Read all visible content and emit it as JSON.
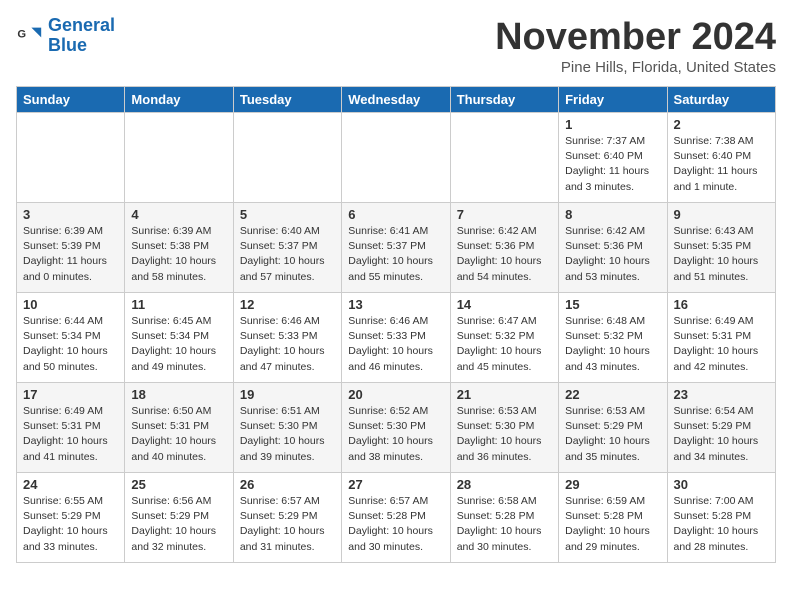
{
  "header": {
    "logo_general": "General",
    "logo_blue": "Blue",
    "month": "November 2024",
    "location": "Pine Hills, Florida, United States"
  },
  "weekdays": [
    "Sunday",
    "Monday",
    "Tuesday",
    "Wednesday",
    "Thursday",
    "Friday",
    "Saturday"
  ],
  "weeks": [
    [
      {
        "day": "",
        "info": ""
      },
      {
        "day": "",
        "info": ""
      },
      {
        "day": "",
        "info": ""
      },
      {
        "day": "",
        "info": ""
      },
      {
        "day": "",
        "info": ""
      },
      {
        "day": "1",
        "info": "Sunrise: 7:37 AM\nSunset: 6:40 PM\nDaylight: 11 hours\nand 3 minutes."
      },
      {
        "day": "2",
        "info": "Sunrise: 7:38 AM\nSunset: 6:40 PM\nDaylight: 11 hours\nand 1 minute."
      }
    ],
    [
      {
        "day": "3",
        "info": "Sunrise: 6:39 AM\nSunset: 5:39 PM\nDaylight: 11 hours\nand 0 minutes."
      },
      {
        "day": "4",
        "info": "Sunrise: 6:39 AM\nSunset: 5:38 PM\nDaylight: 10 hours\nand 58 minutes."
      },
      {
        "day": "5",
        "info": "Sunrise: 6:40 AM\nSunset: 5:37 PM\nDaylight: 10 hours\nand 57 minutes."
      },
      {
        "day": "6",
        "info": "Sunrise: 6:41 AM\nSunset: 5:37 PM\nDaylight: 10 hours\nand 55 minutes."
      },
      {
        "day": "7",
        "info": "Sunrise: 6:42 AM\nSunset: 5:36 PM\nDaylight: 10 hours\nand 54 minutes."
      },
      {
        "day": "8",
        "info": "Sunrise: 6:42 AM\nSunset: 5:36 PM\nDaylight: 10 hours\nand 53 minutes."
      },
      {
        "day": "9",
        "info": "Sunrise: 6:43 AM\nSunset: 5:35 PM\nDaylight: 10 hours\nand 51 minutes."
      }
    ],
    [
      {
        "day": "10",
        "info": "Sunrise: 6:44 AM\nSunset: 5:34 PM\nDaylight: 10 hours\nand 50 minutes."
      },
      {
        "day": "11",
        "info": "Sunrise: 6:45 AM\nSunset: 5:34 PM\nDaylight: 10 hours\nand 49 minutes."
      },
      {
        "day": "12",
        "info": "Sunrise: 6:46 AM\nSunset: 5:33 PM\nDaylight: 10 hours\nand 47 minutes."
      },
      {
        "day": "13",
        "info": "Sunrise: 6:46 AM\nSunset: 5:33 PM\nDaylight: 10 hours\nand 46 minutes."
      },
      {
        "day": "14",
        "info": "Sunrise: 6:47 AM\nSunset: 5:32 PM\nDaylight: 10 hours\nand 45 minutes."
      },
      {
        "day": "15",
        "info": "Sunrise: 6:48 AM\nSunset: 5:32 PM\nDaylight: 10 hours\nand 43 minutes."
      },
      {
        "day": "16",
        "info": "Sunrise: 6:49 AM\nSunset: 5:31 PM\nDaylight: 10 hours\nand 42 minutes."
      }
    ],
    [
      {
        "day": "17",
        "info": "Sunrise: 6:49 AM\nSunset: 5:31 PM\nDaylight: 10 hours\nand 41 minutes."
      },
      {
        "day": "18",
        "info": "Sunrise: 6:50 AM\nSunset: 5:31 PM\nDaylight: 10 hours\nand 40 minutes."
      },
      {
        "day": "19",
        "info": "Sunrise: 6:51 AM\nSunset: 5:30 PM\nDaylight: 10 hours\nand 39 minutes."
      },
      {
        "day": "20",
        "info": "Sunrise: 6:52 AM\nSunset: 5:30 PM\nDaylight: 10 hours\nand 38 minutes."
      },
      {
        "day": "21",
        "info": "Sunrise: 6:53 AM\nSunset: 5:30 PM\nDaylight: 10 hours\nand 36 minutes."
      },
      {
        "day": "22",
        "info": "Sunrise: 6:53 AM\nSunset: 5:29 PM\nDaylight: 10 hours\nand 35 minutes."
      },
      {
        "day": "23",
        "info": "Sunrise: 6:54 AM\nSunset: 5:29 PM\nDaylight: 10 hours\nand 34 minutes."
      }
    ],
    [
      {
        "day": "24",
        "info": "Sunrise: 6:55 AM\nSunset: 5:29 PM\nDaylight: 10 hours\nand 33 minutes."
      },
      {
        "day": "25",
        "info": "Sunrise: 6:56 AM\nSunset: 5:29 PM\nDaylight: 10 hours\nand 32 minutes."
      },
      {
        "day": "26",
        "info": "Sunrise: 6:57 AM\nSunset: 5:29 PM\nDaylight: 10 hours\nand 31 minutes."
      },
      {
        "day": "27",
        "info": "Sunrise: 6:57 AM\nSunset: 5:28 PM\nDaylight: 10 hours\nand 30 minutes."
      },
      {
        "day": "28",
        "info": "Sunrise: 6:58 AM\nSunset: 5:28 PM\nDaylight: 10 hours\nand 30 minutes."
      },
      {
        "day": "29",
        "info": "Sunrise: 6:59 AM\nSunset: 5:28 PM\nDaylight: 10 hours\nand 29 minutes."
      },
      {
        "day": "30",
        "info": "Sunrise: 7:00 AM\nSunset: 5:28 PM\nDaylight: 10 hours\nand 28 minutes."
      }
    ]
  ]
}
